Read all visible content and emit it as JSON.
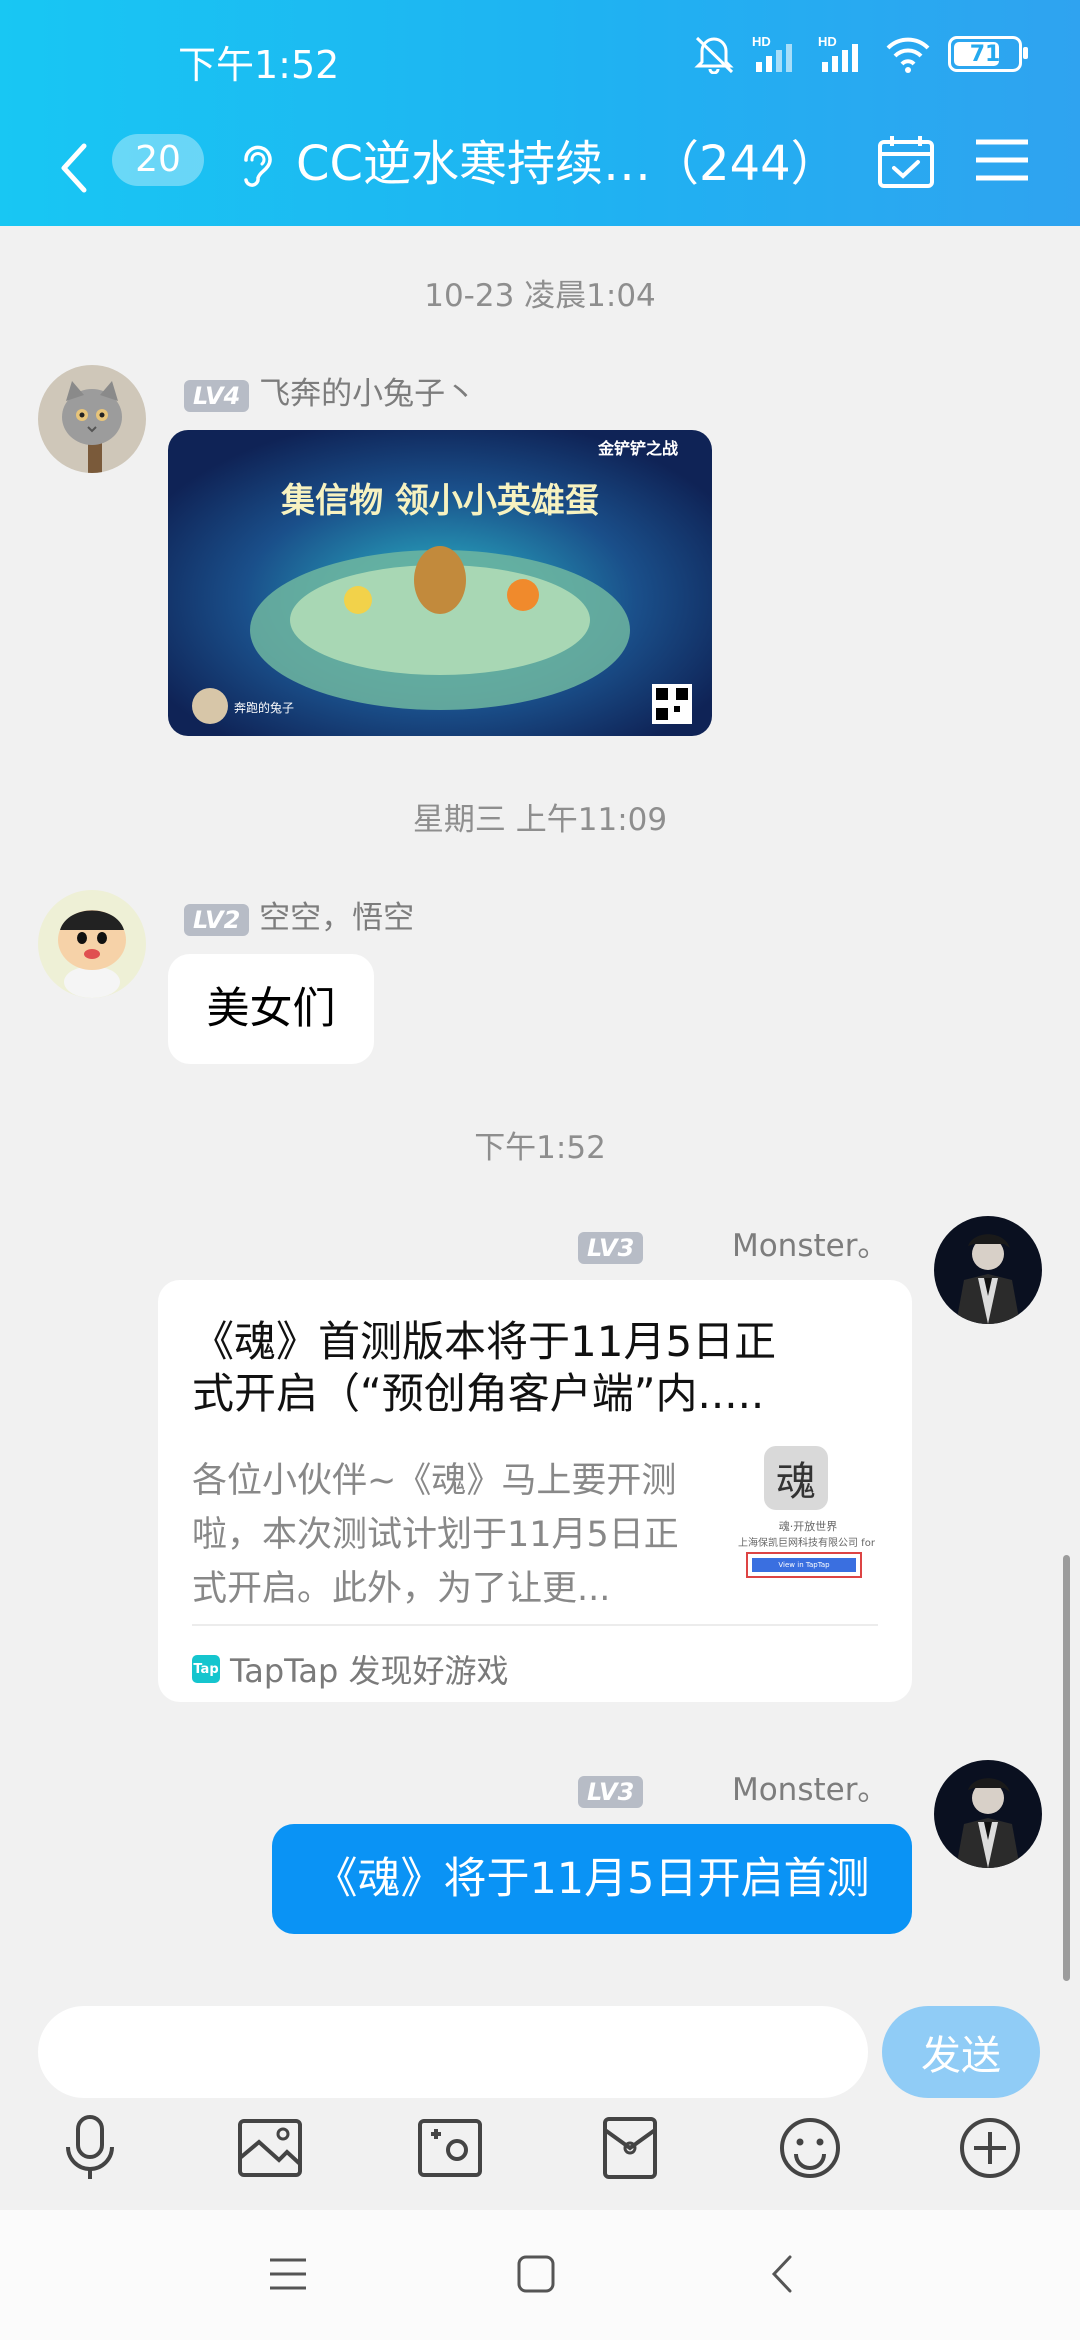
{
  "status_bar": {
    "time": "下午1:52",
    "signal_label_1": "HD",
    "signal_label_2": "HD",
    "battery": "71"
  },
  "header": {
    "unread_count": "20",
    "title": "CC逆水寒持续…（244）"
  },
  "messages": [
    {
      "timestamp": "10-23 凌晨1:04",
      "level": "LV4",
      "nickname": "飞奔的小兔子丶",
      "image": {
        "banner_text": "集信物 领小小英雄蛋",
        "game_logo_text": "金铲铲之战",
        "avatar_caption": "奔跑的兔子"
      }
    },
    {
      "timestamp": "星期三 上午11:09",
      "level": "LV2",
      "nickname": "空空，悟空",
      "text": "美女们"
    },
    {
      "timestamp": "下午1:52",
      "level": "LV3",
      "nickname": "Monster。",
      "card": {
        "title": "《魂》首测版本将于11月5日正式开启（“预创角客户端”内.....",
        "description": "各位小伙伴~《魂》马上要开测啦，本次测试计划于11月5日正式开启。此外，为了让更...",
        "thumb_text": "魂",
        "thumb_caption": "魂·开放世界",
        "thumb_company": "上海保凯巨网科技有限公司 for it",
        "thumb_button": "View in TapTap",
        "source_logo": "Tap",
        "source": "TapTap 发现好游戏"
      }
    },
    {
      "level": "LV3",
      "nickname": "Monster。",
      "text": "《魂》将于11月5日开启首测"
    }
  ],
  "input": {
    "placeholder": "",
    "send_label": "发送"
  },
  "toolbar": [
    "microphone-icon",
    "image-icon",
    "camera-icon",
    "red-packet-icon",
    "emoji-icon",
    "plus-icon"
  ]
}
